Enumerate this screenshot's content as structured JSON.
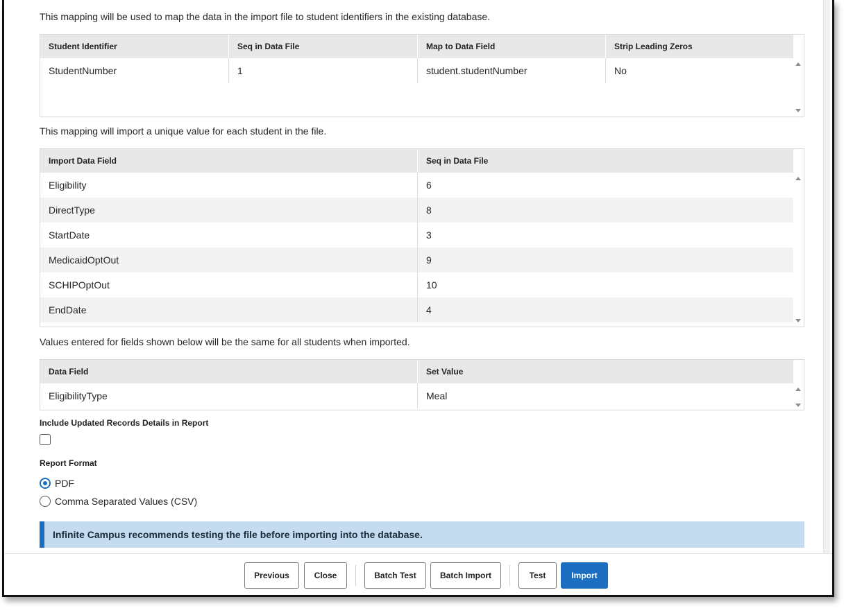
{
  "intro": {
    "identifier_mapping": "This mapping will be used to map the data in the import file to student identifiers in the existing database.",
    "unique_mapping": "This mapping will import a unique value for each student in the file.",
    "set_values": "Values entered for fields shown below will be the same for all students when imported."
  },
  "identifier_grid": {
    "headers": [
      "Student Identifier",
      "Seq in Data File",
      "Map to Data Field",
      "Strip Leading Zeros"
    ],
    "rows": [
      [
        "StudentNumber",
        "1",
        "student.studentNumber",
        "No"
      ]
    ]
  },
  "import_grid": {
    "headers": [
      "Import Data Field",
      "Seq in Data File"
    ],
    "rows": [
      [
        "Eligibility",
        "6"
      ],
      [
        "DirectType",
        "8"
      ],
      [
        "StartDate",
        "3"
      ],
      [
        "MedicaidOptOut",
        "9"
      ],
      [
        "SCHIPOptOut",
        "10"
      ],
      [
        "EndDate",
        "4"
      ]
    ]
  },
  "set_value_grid": {
    "headers": [
      "Data Field",
      "Set Value"
    ],
    "rows": [
      [
        "EligibilityType",
        "Meal"
      ]
    ]
  },
  "options": {
    "include_updated_label": "Include Updated Records Details in Report",
    "include_updated_checked": false,
    "report_format_label": "Report Format",
    "formats": [
      "PDF",
      "Comma Separated Values (CSV)"
    ],
    "selected_format": "PDF"
  },
  "banner": {
    "text": "Infinite Campus recommends testing the file before importing into the database.",
    "color": "#c5dcf0",
    "accent": "#1c6ec0"
  },
  "footer": {
    "previous": "Previous",
    "close": "Close",
    "batch_test": "Batch Test",
    "batch_import": "Batch Import",
    "test": "Test",
    "import": "Import"
  }
}
